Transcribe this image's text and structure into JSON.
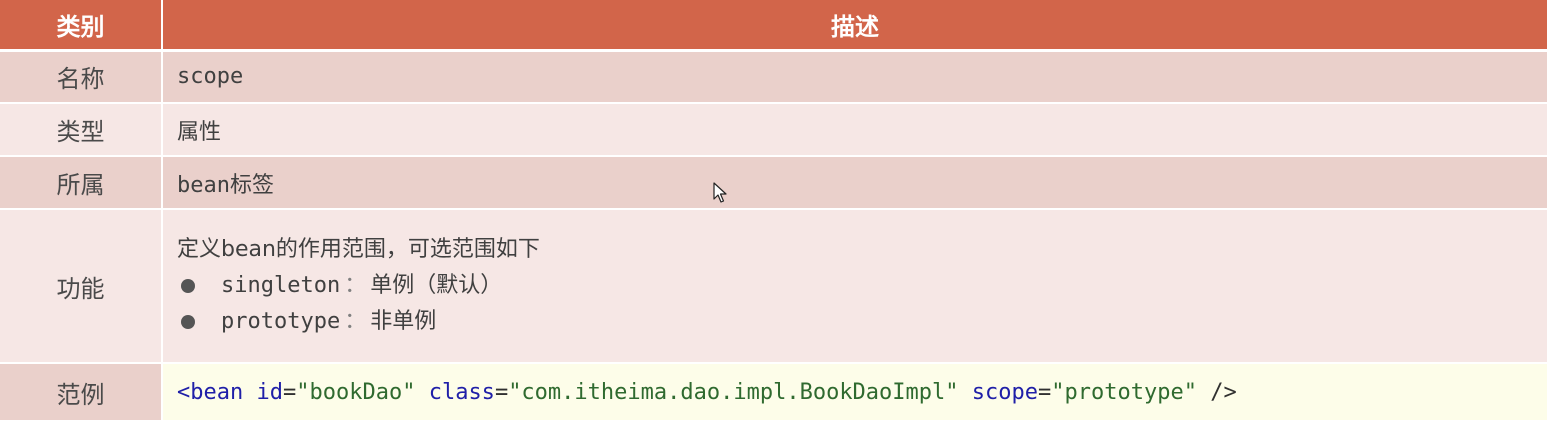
{
  "header": {
    "col1": "类别",
    "col2": "描述"
  },
  "rows": {
    "name": {
      "label": "名称",
      "value": "scope"
    },
    "type": {
      "label": "类型",
      "value": "属性"
    },
    "belongs": {
      "label": "所属",
      "value_mono": "bean",
      "value_text": "标签"
    },
    "function": {
      "label": "功能",
      "intro": "定义bean的作用范围，可选范围如下",
      "options": [
        {
          "key": "singleton",
          "sep": "：",
          "desc": "单例（默认）"
        },
        {
          "key": "prototype",
          "sep": "：",
          "desc": "非单例"
        }
      ]
    },
    "example": {
      "label": "范例",
      "code": {
        "open": "<bean",
        "attr1": "id",
        "val1": "\"bookDao\"",
        "attr2": "class",
        "val2": "\"com.itheima.dao.impl.BookDaoImpl\"",
        "attr3": "scope",
        "val3": "\"prototype\"",
        "close": "/>"
      }
    }
  },
  "colors": {
    "header_bg": "#d2654a",
    "row_dark": "#ead0cb",
    "row_light": "#f6e7e5",
    "code_bg": "#fdfde9"
  },
  "icons": {
    "cursor": "mouse-pointer-icon",
    "bullet": "bullet-dot-icon"
  }
}
